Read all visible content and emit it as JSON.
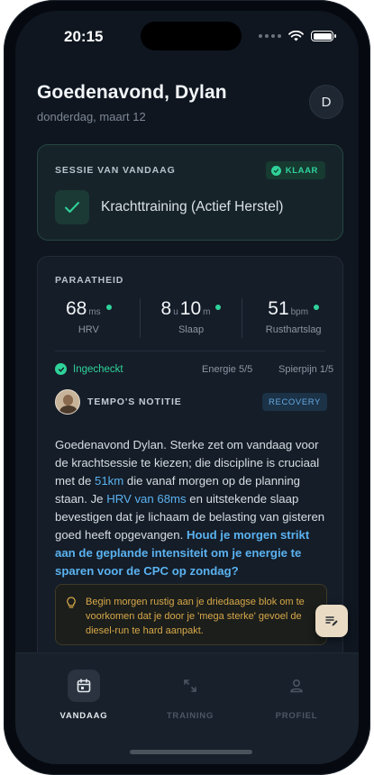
{
  "status_bar": {
    "time": "20:15"
  },
  "header": {
    "greeting": "Goedenavond, Dylan",
    "date": "donderdag, maart 12",
    "avatar_initial": "D"
  },
  "session": {
    "title": "SESSIE VAN VANDAAG",
    "badge": "KLAAR",
    "name": "Krachttraining (Actief Herstel)"
  },
  "readiness": {
    "title": "PARAATHEID",
    "metrics": [
      {
        "value": "68",
        "unit": "ms",
        "label": "HRV"
      },
      {
        "value_h": "8",
        "unit_h": "u",
        "value_m": "10",
        "unit_m": "m",
        "label": "Slaap"
      },
      {
        "value": "51",
        "unit": "bpm",
        "label": "Rusthartslag"
      }
    ],
    "checked_in": "Ingecheckt",
    "energy": "Energie 5/5",
    "soreness": "Spierpijn 1/5"
  },
  "coach": {
    "label": "TEMPO'S NOTITIE",
    "tag": "RECOVERY",
    "note": {
      "p1": "Goedenavond Dylan. Sterke zet om vandaag voor de krachtsessie te kiezen; die discipline is cruciaal met de ",
      "h1": "51km",
      "p2": " die vanaf morgen op de planning staan. Je ",
      "h2": "HRV van 68ms",
      "p3": " en uitstekende slaap bevestigen dat je lichaam de belasting van gisteren goed heeft opgevangen. ",
      "h3": "Houd je morgen strikt aan de geplande intensiteit om je energie te sparen voor de CPC op zondag?"
    },
    "tip": "Begin morgen rustig aan je driedaagse blok om te voorkomen dat je door je 'mega sterke' gevoel de diesel-run te hard aanpakt."
  },
  "nav": [
    {
      "label": "VANDAAG",
      "icon": "calendar-icon",
      "active": true
    },
    {
      "label": "TRAINING",
      "icon": "arrows-icon",
      "active": false
    },
    {
      "label": "PROFIEL",
      "icon": "user-icon",
      "active": false
    }
  ],
  "colors": {
    "accent_green": "#2fd39a",
    "accent_blue": "#5ab2f0",
    "accent_amber": "#d8a849",
    "background": "#0f1620"
  }
}
